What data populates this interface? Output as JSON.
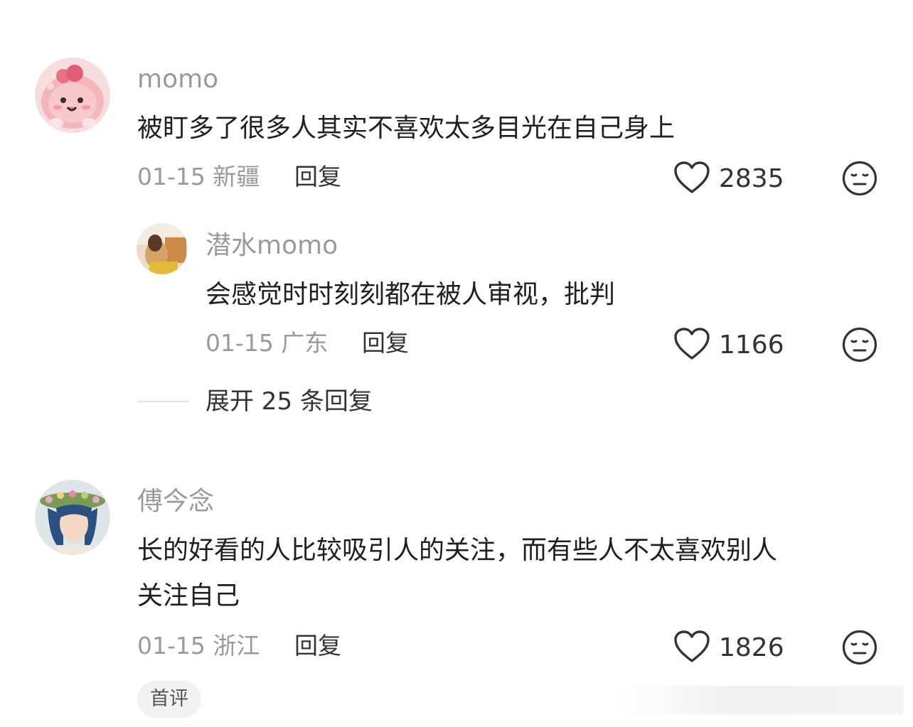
{
  "comments": [
    {
      "username": "momo",
      "text": "被盯多了很多人其实不喜欢太多目光在自己身上",
      "date": "01-15",
      "location": "新疆",
      "reply_label": "回复",
      "likes": "2835",
      "avatar_icon": "pink-character-avatar"
    },
    {
      "username": "潜水momo",
      "text": "会感觉时时刻刻都在被人审视，批判",
      "date": "01-15",
      "location": "广东",
      "reply_label": "回复",
      "likes": "1166",
      "avatar_icon": "photo-avatar"
    },
    {
      "username": "傅今念",
      "text_line1": "长的好看的人比较吸引人的关注，而有些人不太喜欢别人",
      "text_line2": "关注自己",
      "date": "01-15",
      "location": "浙江",
      "reply_label": "回复",
      "likes": "1826",
      "badge": "首评",
      "avatar_icon": "illustrated-girl-avatar"
    }
  ],
  "expand_replies": "展开 25 条回复",
  "icons": {
    "like": "heart-outline-icon",
    "dislike": "meh-face-icon"
  },
  "colors": {
    "muted": "#9a9a9a",
    "text": "#1f1f1f",
    "badge_bg": "#f2f2f2"
  }
}
